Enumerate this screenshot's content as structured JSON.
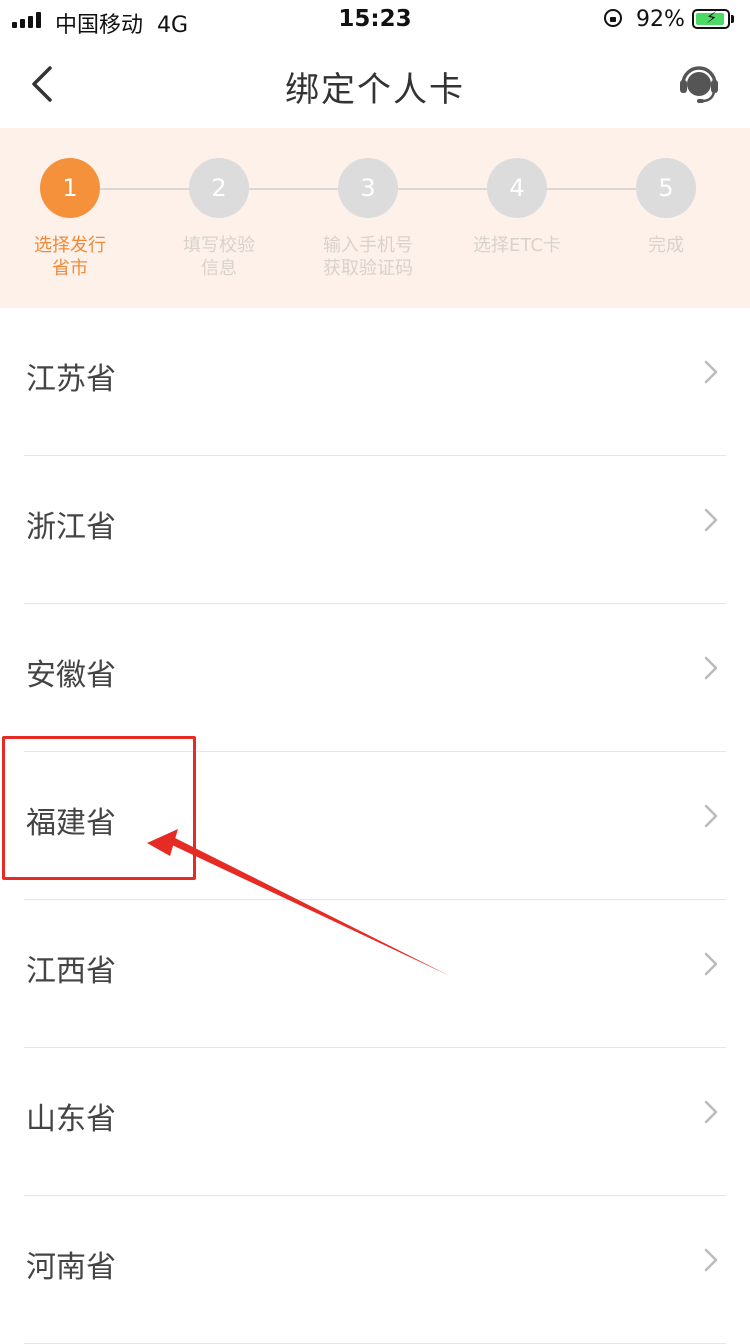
{
  "status_bar": {
    "carrier": "中国移动",
    "network": "4G",
    "time": "15:23",
    "battery": "92%",
    "battery_level": 0.92,
    "icons": [
      "signal-icon",
      "rotation-lock-icon",
      "battery-charging-icon"
    ]
  },
  "nav": {
    "title": "绑定个人卡",
    "back_icon": "chevron-left-icon",
    "service_icon": "headset-icon"
  },
  "stepper": {
    "active_step": 1,
    "accent_color": "#f5913b",
    "steps": [
      {
        "number": "1",
        "label": "选择发行\n省市"
      },
      {
        "number": "2",
        "label": "填写校验\n信息"
      },
      {
        "number": "3",
        "label": "输入手机号\n获取验证码"
      },
      {
        "number": "4",
        "label": "选择ETC卡"
      },
      {
        "number": "5",
        "label": "完成"
      }
    ]
  },
  "provinces": [
    {
      "label": "江苏省"
    },
    {
      "label": "浙江省"
    },
    {
      "label": "安徽省"
    },
    {
      "label": "福建省"
    },
    {
      "label": "江西省"
    },
    {
      "label": "山东省"
    },
    {
      "label": "河南省"
    }
  ],
  "annotation": {
    "highlighted_item": "福建省",
    "color": "#e52b23"
  }
}
